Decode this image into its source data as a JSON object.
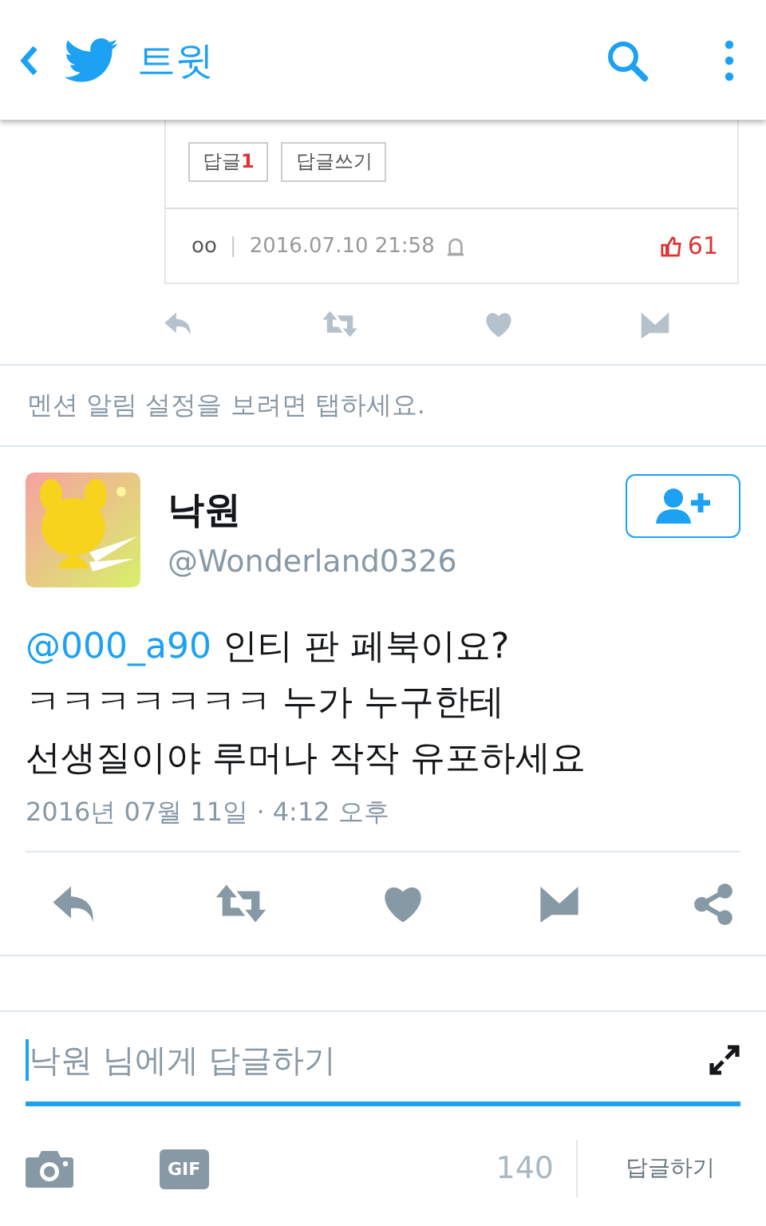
{
  "header": {
    "title": "트윗"
  },
  "embedded_card": {
    "buttons": [
      {
        "label": "답글",
        "count": "1"
      },
      {
        "label": "답글쓰기"
      }
    ],
    "author": "oo",
    "separator": "|",
    "timestamp": "2016.07.10 21:58",
    "likes": "61"
  },
  "mention_notice": "멘션 알림 설정을 보려면 탭하세요.",
  "tweet": {
    "name": "낙원",
    "handle": "@Wonderland0326",
    "mention": "@000_a90",
    "lines": [
      "인티 판 페북이요?",
      "ㅋㅋㅋㅋㅋㅋㅋ 누가 누구한테",
      "선생질이야 루머나 작작 유포하세요"
    ],
    "date": "2016년 07월 11일 · 4:12 오후"
  },
  "reply_box": {
    "placeholder": "낙원 님에게 답글하기",
    "gif": "GIF",
    "count": "140",
    "submit": "답글하기"
  }
}
